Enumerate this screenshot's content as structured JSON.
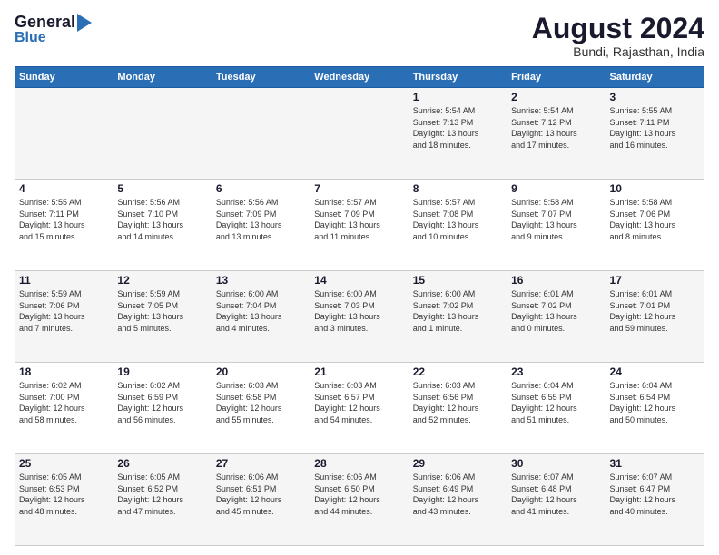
{
  "header": {
    "logo_general": "General",
    "logo_blue": "Blue",
    "main_title": "August 2024",
    "subtitle": "Bundi, Rajasthan, India"
  },
  "weekdays": [
    "Sunday",
    "Monday",
    "Tuesday",
    "Wednesday",
    "Thursday",
    "Friday",
    "Saturday"
  ],
  "weeks": [
    [
      {
        "day": "",
        "info": ""
      },
      {
        "day": "",
        "info": ""
      },
      {
        "day": "",
        "info": ""
      },
      {
        "day": "",
        "info": ""
      },
      {
        "day": "1",
        "info": "Sunrise: 5:54 AM\nSunset: 7:13 PM\nDaylight: 13 hours\nand 18 minutes."
      },
      {
        "day": "2",
        "info": "Sunrise: 5:54 AM\nSunset: 7:12 PM\nDaylight: 13 hours\nand 17 minutes."
      },
      {
        "day": "3",
        "info": "Sunrise: 5:55 AM\nSunset: 7:11 PM\nDaylight: 13 hours\nand 16 minutes."
      }
    ],
    [
      {
        "day": "4",
        "info": "Sunrise: 5:55 AM\nSunset: 7:11 PM\nDaylight: 13 hours\nand 15 minutes."
      },
      {
        "day": "5",
        "info": "Sunrise: 5:56 AM\nSunset: 7:10 PM\nDaylight: 13 hours\nand 14 minutes."
      },
      {
        "day": "6",
        "info": "Sunrise: 5:56 AM\nSunset: 7:09 PM\nDaylight: 13 hours\nand 13 minutes."
      },
      {
        "day": "7",
        "info": "Sunrise: 5:57 AM\nSunset: 7:09 PM\nDaylight: 13 hours\nand 11 minutes."
      },
      {
        "day": "8",
        "info": "Sunrise: 5:57 AM\nSunset: 7:08 PM\nDaylight: 13 hours\nand 10 minutes."
      },
      {
        "day": "9",
        "info": "Sunrise: 5:58 AM\nSunset: 7:07 PM\nDaylight: 13 hours\nand 9 minutes."
      },
      {
        "day": "10",
        "info": "Sunrise: 5:58 AM\nSunset: 7:06 PM\nDaylight: 13 hours\nand 8 minutes."
      }
    ],
    [
      {
        "day": "11",
        "info": "Sunrise: 5:59 AM\nSunset: 7:06 PM\nDaylight: 13 hours\nand 7 minutes."
      },
      {
        "day": "12",
        "info": "Sunrise: 5:59 AM\nSunset: 7:05 PM\nDaylight: 13 hours\nand 5 minutes."
      },
      {
        "day": "13",
        "info": "Sunrise: 6:00 AM\nSunset: 7:04 PM\nDaylight: 13 hours\nand 4 minutes."
      },
      {
        "day": "14",
        "info": "Sunrise: 6:00 AM\nSunset: 7:03 PM\nDaylight: 13 hours\nand 3 minutes."
      },
      {
        "day": "15",
        "info": "Sunrise: 6:00 AM\nSunset: 7:02 PM\nDaylight: 13 hours\nand 1 minute."
      },
      {
        "day": "16",
        "info": "Sunrise: 6:01 AM\nSunset: 7:02 PM\nDaylight: 13 hours\nand 0 minutes."
      },
      {
        "day": "17",
        "info": "Sunrise: 6:01 AM\nSunset: 7:01 PM\nDaylight: 12 hours\nand 59 minutes."
      }
    ],
    [
      {
        "day": "18",
        "info": "Sunrise: 6:02 AM\nSunset: 7:00 PM\nDaylight: 12 hours\nand 58 minutes."
      },
      {
        "day": "19",
        "info": "Sunrise: 6:02 AM\nSunset: 6:59 PM\nDaylight: 12 hours\nand 56 minutes."
      },
      {
        "day": "20",
        "info": "Sunrise: 6:03 AM\nSunset: 6:58 PM\nDaylight: 12 hours\nand 55 minutes."
      },
      {
        "day": "21",
        "info": "Sunrise: 6:03 AM\nSunset: 6:57 PM\nDaylight: 12 hours\nand 54 minutes."
      },
      {
        "day": "22",
        "info": "Sunrise: 6:03 AM\nSunset: 6:56 PM\nDaylight: 12 hours\nand 52 minutes."
      },
      {
        "day": "23",
        "info": "Sunrise: 6:04 AM\nSunset: 6:55 PM\nDaylight: 12 hours\nand 51 minutes."
      },
      {
        "day": "24",
        "info": "Sunrise: 6:04 AM\nSunset: 6:54 PM\nDaylight: 12 hours\nand 50 minutes."
      }
    ],
    [
      {
        "day": "25",
        "info": "Sunrise: 6:05 AM\nSunset: 6:53 PM\nDaylight: 12 hours\nand 48 minutes."
      },
      {
        "day": "26",
        "info": "Sunrise: 6:05 AM\nSunset: 6:52 PM\nDaylight: 12 hours\nand 47 minutes."
      },
      {
        "day": "27",
        "info": "Sunrise: 6:06 AM\nSunset: 6:51 PM\nDaylight: 12 hours\nand 45 minutes."
      },
      {
        "day": "28",
        "info": "Sunrise: 6:06 AM\nSunset: 6:50 PM\nDaylight: 12 hours\nand 44 minutes."
      },
      {
        "day": "29",
        "info": "Sunrise: 6:06 AM\nSunset: 6:49 PM\nDaylight: 12 hours\nand 43 minutes."
      },
      {
        "day": "30",
        "info": "Sunrise: 6:07 AM\nSunset: 6:48 PM\nDaylight: 12 hours\nand 41 minutes."
      },
      {
        "day": "31",
        "info": "Sunrise: 6:07 AM\nSunset: 6:47 PM\nDaylight: 12 hours\nand 40 minutes."
      }
    ]
  ]
}
